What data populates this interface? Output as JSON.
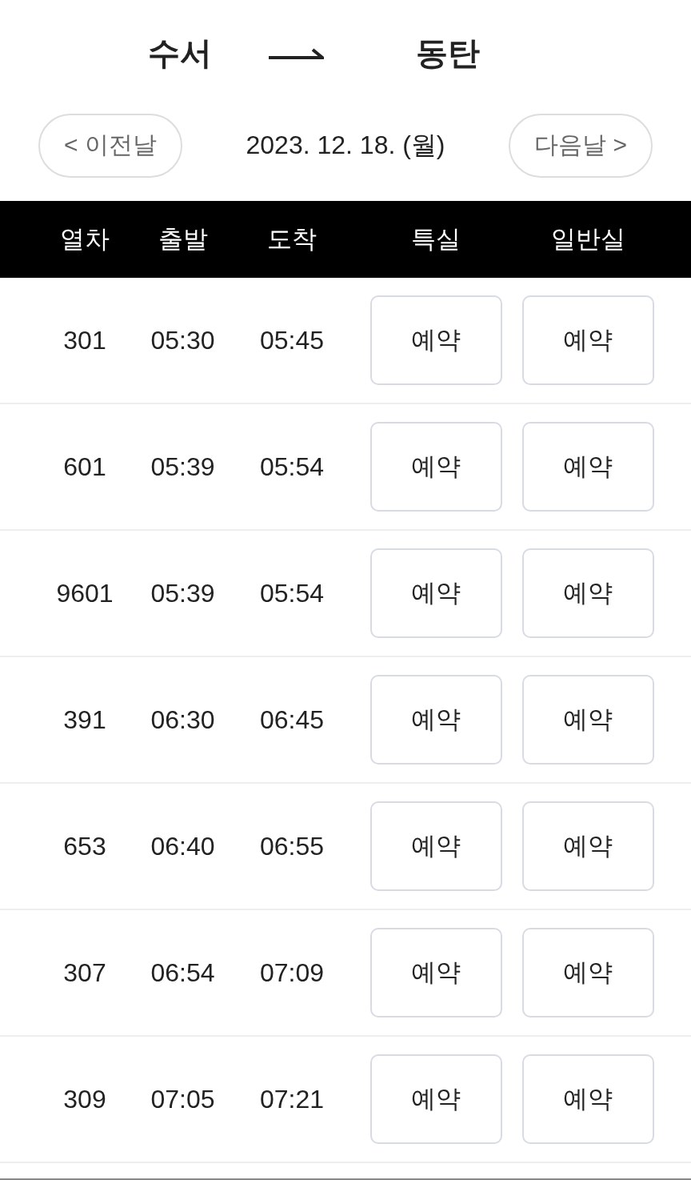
{
  "route": {
    "from": "수서",
    "to": "동탄"
  },
  "date_nav": {
    "prev": "< 이전날",
    "date": "2023. 12. 18. (월)",
    "next": "다음날 >"
  },
  "table": {
    "columns": [
      "열차",
      "출발",
      "도착",
      "특실",
      "일반실"
    ],
    "rows": [
      {
        "train": "301",
        "depart": "05:30",
        "arrive": "05:45",
        "special": "예약",
        "general": "예약"
      },
      {
        "train": "601",
        "depart": "05:39",
        "arrive": "05:54",
        "special": "예약",
        "general": "예약"
      },
      {
        "train": "9601",
        "depart": "05:39",
        "arrive": "05:54",
        "special": "예약",
        "general": "예약"
      },
      {
        "train": "391",
        "depart": "06:30",
        "arrive": "06:45",
        "special": "예약",
        "general": "예약"
      },
      {
        "train": "653",
        "depart": "06:40",
        "arrive": "06:55",
        "special": "예약",
        "general": "예약"
      },
      {
        "train": "307",
        "depart": "06:54",
        "arrive": "07:09",
        "special": "예약",
        "general": "예약"
      },
      {
        "train": "309",
        "depart": "07:05",
        "arrive": "07:21",
        "special": "예약",
        "general": "예약"
      }
    ]
  }
}
